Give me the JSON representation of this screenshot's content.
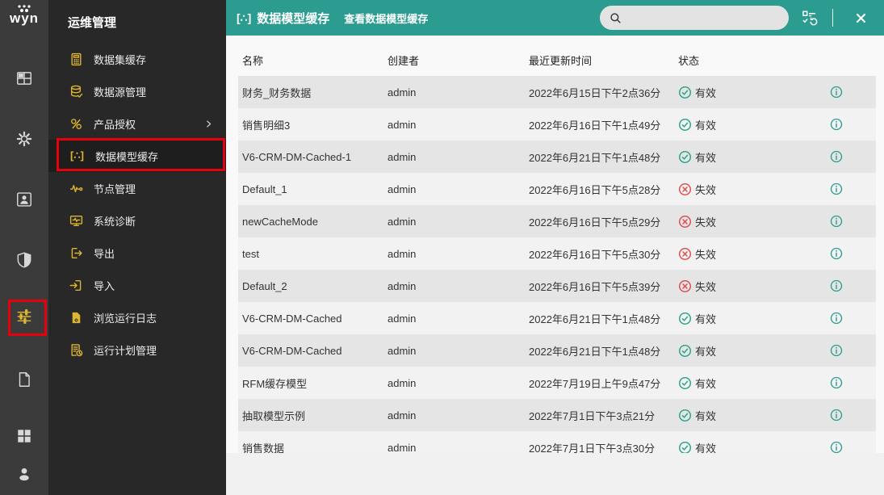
{
  "colors": {
    "accent": "#2b9c8f",
    "gold": "#deb530",
    "valid_green": "#27a186",
    "invalid_red": "#e0484b",
    "highlight_red": "#e8000d"
  },
  "brand": {
    "logo_text": "wyn"
  },
  "rail": {
    "items": [
      {
        "name": "window"
      },
      {
        "name": "gear"
      },
      {
        "name": "user-card"
      },
      {
        "name": "shield"
      },
      {
        "name": "sliders",
        "highlighted": true
      },
      {
        "name": "document"
      },
      {
        "name": "grid"
      },
      {
        "name": "person"
      }
    ]
  },
  "sidebar": {
    "title": "运维管理",
    "items": [
      {
        "label": "数据集缓存",
        "icon": "dataset-cache"
      },
      {
        "label": "数据源管理",
        "icon": "datasource"
      },
      {
        "label": "产品授权",
        "icon": "license",
        "has_submenu": true
      },
      {
        "label": "数据模型缓存",
        "icon": "data-model",
        "active": true,
        "highlighted": true
      },
      {
        "label": "节点管理",
        "icon": "node"
      },
      {
        "label": "系统诊断",
        "icon": "diagnosis"
      },
      {
        "label": "导出",
        "icon": "export"
      },
      {
        "label": "导入",
        "icon": "import"
      },
      {
        "label": "浏览运行日志",
        "icon": "logs"
      },
      {
        "label": "运行计划管理",
        "icon": "schedule"
      }
    ]
  },
  "header": {
    "title_icon": "[∴]",
    "title": "数据模型缓存",
    "subtitle": "查看数据模型缓存",
    "search_value": "",
    "search_placeholder": ""
  },
  "table": {
    "columns": [
      "名称",
      "创建者",
      "最近更新时间",
      "状态"
    ],
    "rows": [
      {
        "name": "财务_财务数据",
        "creator": "admin",
        "updated": "2022年6月15日下午2点36分",
        "status": "有效",
        "valid": true
      },
      {
        "name": "销售明细3",
        "creator": "admin",
        "updated": "2022年6月16日下午1点49分",
        "status": "有效",
        "valid": true
      },
      {
        "name": "V6-CRM-DM-Cached-1",
        "creator": "admin",
        "updated": "2022年6月21日下午1点48分",
        "status": "有效",
        "valid": true
      },
      {
        "name": "Default_1",
        "creator": "admin",
        "updated": "2022年6月16日下午5点28分",
        "status": "失效",
        "valid": false
      },
      {
        "name": "newCacheMode",
        "creator": "admin",
        "updated": "2022年6月16日下午5点29分",
        "status": "失效",
        "valid": false
      },
      {
        "name": "test",
        "creator": "admin",
        "updated": "2022年6月16日下午5点30分",
        "status": "失效",
        "valid": false
      },
      {
        "name": "Default_2",
        "creator": "admin",
        "updated": "2022年6月16日下午5点39分",
        "status": "失效",
        "valid": false
      },
      {
        "name": "V6-CRM-DM-Cached",
        "creator": "admin",
        "updated": "2022年6月21日下午1点48分",
        "status": "有效",
        "valid": true
      },
      {
        "name": "V6-CRM-DM-Cached",
        "creator": "admin",
        "updated": "2022年6月21日下午1点48分",
        "status": "有效",
        "valid": true
      },
      {
        "name": "RFM缓存模型",
        "creator": "admin",
        "updated": "2022年7月19日上午9点47分",
        "status": "有效",
        "valid": true
      },
      {
        "name": "抽取模型示例",
        "creator": "admin",
        "updated": "2022年7月1日下午3点21分",
        "status": "有效",
        "valid": true
      },
      {
        "name": "销售数据",
        "creator": "admin",
        "updated": "2022年7月1日下午3点30分",
        "status": "有效",
        "valid": true
      }
    ]
  }
}
